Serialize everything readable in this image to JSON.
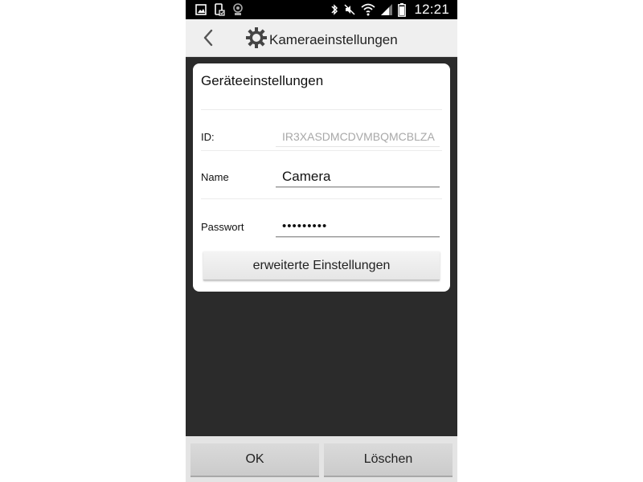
{
  "status_bar": {
    "time": "12:21",
    "left_icons": [
      "gallery-notification-icon",
      "screenshot-notification-icon",
      "camera-app-notification-icon"
    ],
    "right_icons": [
      "bluetooth-icon",
      "mute-icon",
      "wifi-icon",
      "signal-icon",
      "battery-icon"
    ]
  },
  "header": {
    "title": "Kameraeinstellungen",
    "back_icon": "chevron-left-icon",
    "title_icon": "gear-icon"
  },
  "device_settings": {
    "heading": "Geräteeinstellungen",
    "id_label": "ID:",
    "id_value": "IR3XASDMCDVMBQMCBLZA",
    "name_label": "Name",
    "name_value": "Camera",
    "password_label": "Passwort",
    "password_mask": "•••••••••",
    "advanced_button_label": "erweiterte Einstellungen"
  },
  "footer": {
    "ok_label": "OK",
    "delete_label": "Löschen"
  },
  "colors": {
    "background_dark": "#2b2b2b",
    "header_bg": "#efefef",
    "status_bar_bg": "#000000",
    "card_bg": "#ffffff",
    "id_text": "#a8a8a8"
  }
}
